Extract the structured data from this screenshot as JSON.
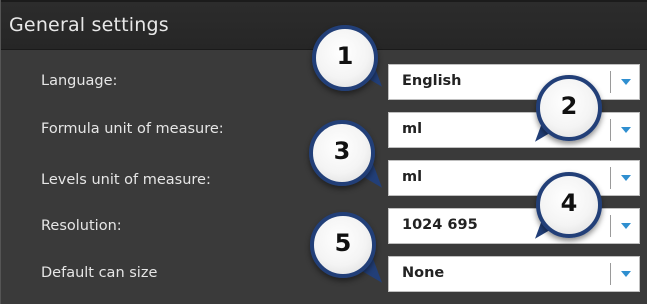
{
  "header": {
    "title": "General settings"
  },
  "rows": [
    {
      "label": "Language:",
      "value": "English"
    },
    {
      "label": "Formula unit of measure:",
      "value": "ml"
    },
    {
      "label": "Levels unit of measure:",
      "value": "ml"
    },
    {
      "label": "Resolution:",
      "value": "1024 695"
    },
    {
      "label": "Default can size",
      "value": "None"
    }
  ],
  "callouts": [
    "1",
    "2",
    "3",
    "4",
    "5"
  ],
  "colors": {
    "header_bg": "#262626",
    "body_bg": "#3a3a3a",
    "dropdown_arrow": "#2f8fd0",
    "callout_border": "#223f78"
  }
}
